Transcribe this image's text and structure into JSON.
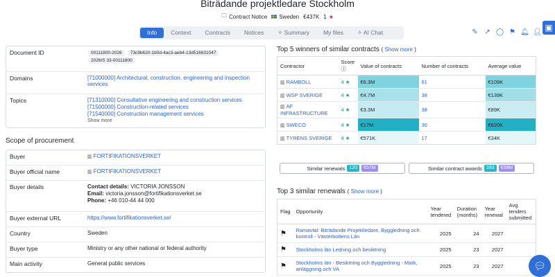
{
  "header": {
    "title": "Biträdande projektledare Stockholm",
    "notice": "Contract Notice",
    "country": "Sweden",
    "value": "€437K",
    "rating": "1"
  },
  "tabs": [
    {
      "label": "Info"
    },
    {
      "label": "Context"
    },
    {
      "label": "Contracts"
    },
    {
      "label": "Notices"
    },
    {
      "label": "✧ Summary"
    },
    {
      "label": "My files"
    },
    {
      "label": "✧ AI Chat"
    }
  ],
  "doc": {
    "id_label": "Document ID",
    "ids": [
      "00111800-2026",
      "73c9b620-1b0d-4ac3-aeb4-13d516631047",
      "2026/S 33-00111800"
    ],
    "domains_label": "Domains",
    "domain": "[71000000] Architectural, construction, engineering and inspection services",
    "topics_label": "Topics",
    "topics": [
      "[71310000] Consultative engineering and construction services",
      "[71500000] Construction-related services",
      "[71540000] Construction management services"
    ],
    "show_more": "Show more"
  },
  "scope": {
    "title": "Scope of procurement",
    "buyer_label": "Buyer",
    "buyer": "FORTIFIKATIONSVERKET",
    "official_label": "Buyer official name",
    "official": "FORTIFIKATIONSVERKET",
    "details_label": "Buyer details",
    "contact_key": "Contact details:",
    "contact_val": "VICTORIA JONSSON",
    "email_key": "Email:",
    "email_val": "victoria.jonsson@fortifikationsverket.se",
    "phone_key": "Phone:",
    "phone_val": "+46 010-44 44 000",
    "url_label": "Buyer external URL",
    "url": "https://www.fortifikationsverket.se/",
    "country_label": "Country",
    "country": "Sweden",
    "type_label": "Buyer type",
    "type": "Ministry or any other national or federal authority",
    "activity_label": "Main activity",
    "activity": "General public services"
  },
  "winners": {
    "title": "Top 5 winners of similar contracts",
    "show_more": "Show more",
    "headers": {
      "contractor": "Contractor",
      "score": "Score",
      "value": "Value of contracts",
      "count": "Number of contracts",
      "avg": "Average value"
    },
    "rows": [
      {
        "name": "RAMBOLL",
        "score": "4",
        "value": "€6.3M",
        "count": "61",
        "avg": "€109K",
        "vcolor": "#7fd3e0",
        "acolor": "#7fd3e0"
      },
      {
        "name": "WSP SVERIGE",
        "score": "4",
        "value": "€4.7M",
        "count": "38",
        "avg": "€139K",
        "vcolor": "#a9e1ea",
        "acolor": "#a1dee8"
      },
      {
        "name": "AF INFRASTRUCTURE",
        "score": "4",
        "value": "€3.3M",
        "count": "38",
        "avg": "€89K",
        "vcolor": "#c4ebf1",
        "acolor": "#c9edf3"
      },
      {
        "name": "SWECO",
        "score": "4",
        "value": "€17M",
        "count": "30",
        "avg": "€620K",
        "vcolor": "#23b0c4",
        "acolor": "#23b0c4"
      },
      {
        "name": "TYRENS SVERIGE",
        "score": "4",
        "value": "€571K",
        "count": "17",
        "avg": "€34K",
        "vcolor": "#e7f6f9",
        "acolor": "#e4f6f8"
      }
    ]
  },
  "similar": {
    "renewals_label": "Similar renewals",
    "renewals_count": "120",
    "renewals_value": "€57M",
    "awards_label": "Similar contract awards",
    "awards_count": "393",
    "awards_value": "€58M",
    "count_color": "#2bb3c8",
    "value_color": "#9b8ff0"
  },
  "renewals": {
    "title": "Top 3 similar renewals",
    "show_more": "Show more",
    "headers": {
      "flag": "Flag",
      "opp": "Opportunity",
      "year": "Year tendered",
      "duration": "Duration (months)",
      "renewal": "Year renewal",
      "avg": "Avg tenders submitted"
    },
    "rows": [
      {
        "opp": "Ramavtal: Biträdande Projektledare, Byggledning och kontroll - Västerbottens Län",
        "year": "2025",
        "duration": "24",
        "renewal": "2027"
      },
      {
        "opp": "Stockholms län Ledning och besiktning",
        "year": "2025",
        "duration": "23",
        "renewal": "2027"
      },
      {
        "opp": "Stockholms län - Besiktning och Byggledning - Mark, anläggning och VA",
        "year": "2025",
        "duration": "23",
        "renewal": "2027"
      }
    ]
  }
}
